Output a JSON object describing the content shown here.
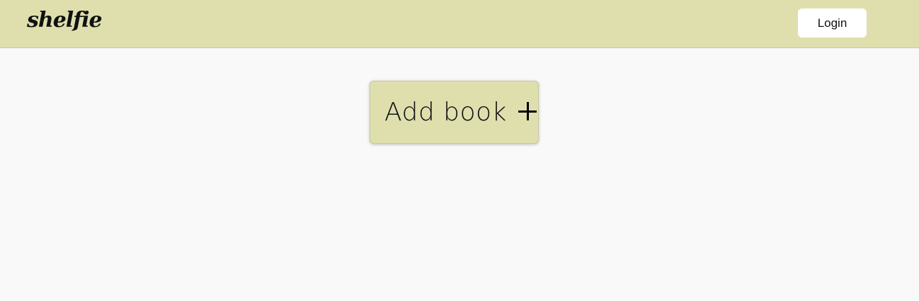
{
  "header": {
    "logo_text": "shelfie",
    "login_label": "Login"
  },
  "main": {
    "add_book_label": "Add book",
    "add_book_icon": "plus-icon"
  },
  "colors": {
    "header_bg": "#dedfad",
    "page_bg": "#f9f9f9",
    "button_bg": "#ffffff"
  }
}
